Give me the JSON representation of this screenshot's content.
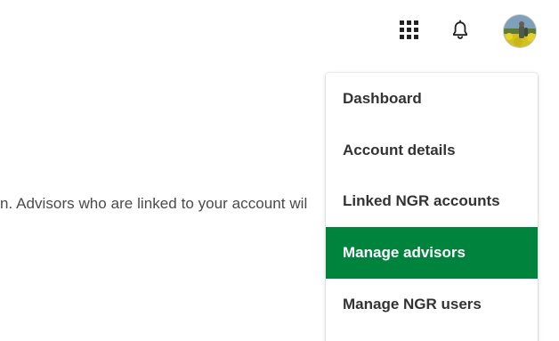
{
  "header": {
    "apps_icon": "apps-grid-icon",
    "notifications_icon": "bell-icon",
    "avatar": "user-avatar"
  },
  "main": {
    "body_text": "n. Advisors who are linked to your account wil"
  },
  "menu": {
    "items": [
      {
        "label": "Dashboard",
        "active": false
      },
      {
        "label": "Account details",
        "active": false
      },
      {
        "label": "Linked NGR accounts",
        "active": false
      },
      {
        "label": "Manage advisors",
        "active": true
      },
      {
        "label": "Manage NGR users",
        "active": false
      }
    ]
  },
  "colors": {
    "active_background": "#00843d",
    "active_text": "#ffffff",
    "menu_text": "#333333",
    "body_text": "#4a4a4a"
  }
}
